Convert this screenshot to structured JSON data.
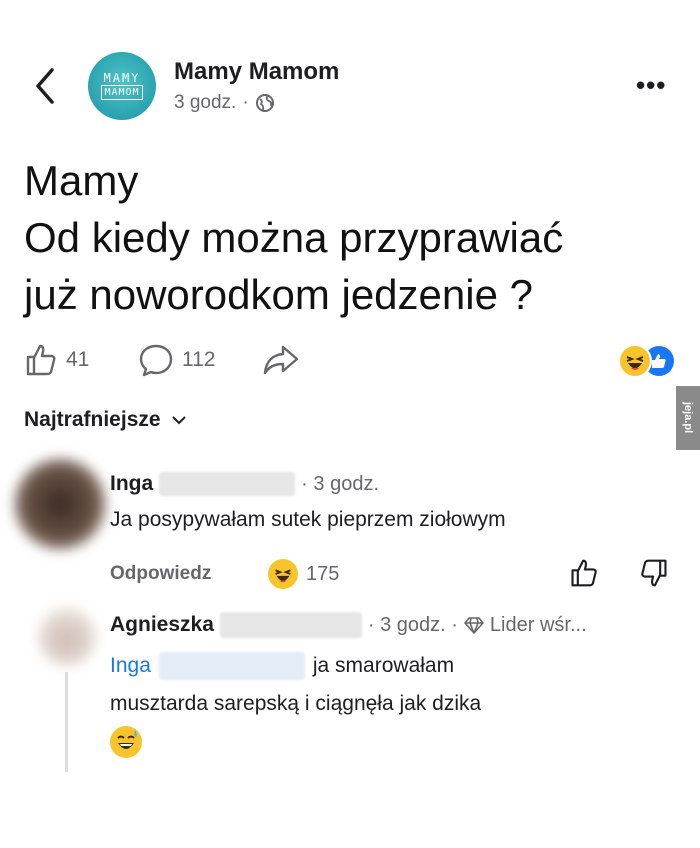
{
  "header": {
    "back_icon": "chevron-left-icon",
    "page_name": "Mamy Mamom",
    "avatar_line1": "MAMY",
    "avatar_line2": "MAMOM",
    "time": "3 godz.",
    "separator": "·",
    "privacy_icon": "globe-icon",
    "more_label": "•••"
  },
  "post": {
    "lines": [
      "Mamy",
      "Od kiedy można przyprawiać",
      "już noworodkom jedzenie ?"
    ]
  },
  "reactions": {
    "like_count": "41",
    "comment_count": "112",
    "summary_icons": [
      "laughing-emoji-icon",
      "like-reaction-icon"
    ]
  },
  "sort": {
    "label": "Najtrafniejsze"
  },
  "watermark": "jeja.pl",
  "comments": [
    {
      "author": "Inga",
      "time": "· 3 godz.",
      "text": "Ja posypywałam sutek pieprzem ziołowym",
      "reply_label": "Odpowiedz",
      "reaction_count": "175"
    },
    {
      "author": "Agnieszka",
      "time": "· 3 godz. ·",
      "badge": "Lider wśr...",
      "mention": "Inga",
      "text_line1": "ja smarowałam",
      "text_line2": "musztarda sarepską i ciągnęła jak dzika"
    }
  ],
  "colors": {
    "link_blue": "#1877f2",
    "meta_gray": "#65676b",
    "avatar_teal": "#2aa3b0"
  }
}
